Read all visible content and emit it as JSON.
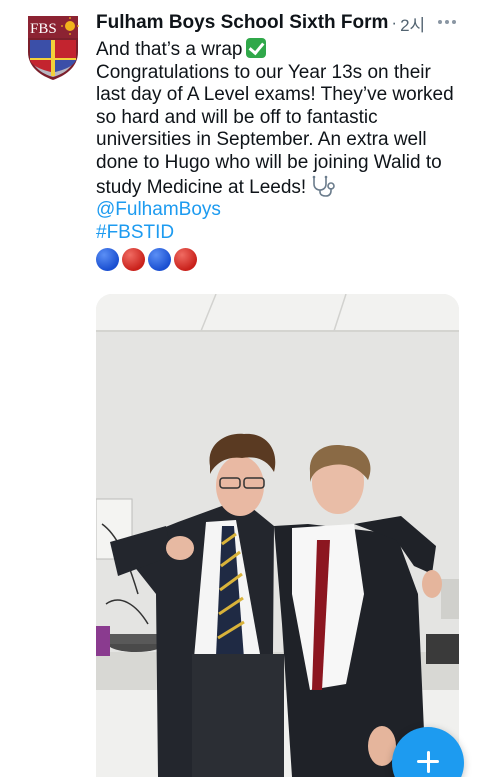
{
  "tweet": {
    "author": "Fulham Boys School Sixth Form",
    "separator": "·",
    "time": "2시",
    "avatar_text": "FBS",
    "more_icon": "more-horizontal-icon",
    "lines": [
      "And that’s a wrap",
      "Congratulations to our Year 13s on their",
      "last day of A Level exams! They’ve worked",
      "so hard and will be off to fantastic",
      "universities in September. An extra well",
      "done to Hugo who will be joining Walid to",
      "study Medicine at Leeds!"
    ],
    "mention": "@FulhamBoys",
    "hashtag": "#FBSTID",
    "emoji_circles": [
      "blue",
      "red",
      "blue",
      "red"
    ],
    "photo_alt": "Two students in school uniform standing together"
  },
  "compose_button": {
    "icon": "plus-icon"
  },
  "colors": {
    "link": "#1d9bf0",
    "text": "#0f1419",
    "muted": "#536471",
    "blue_circle": "#1a4fd1",
    "red_circle": "#c9211b"
  }
}
